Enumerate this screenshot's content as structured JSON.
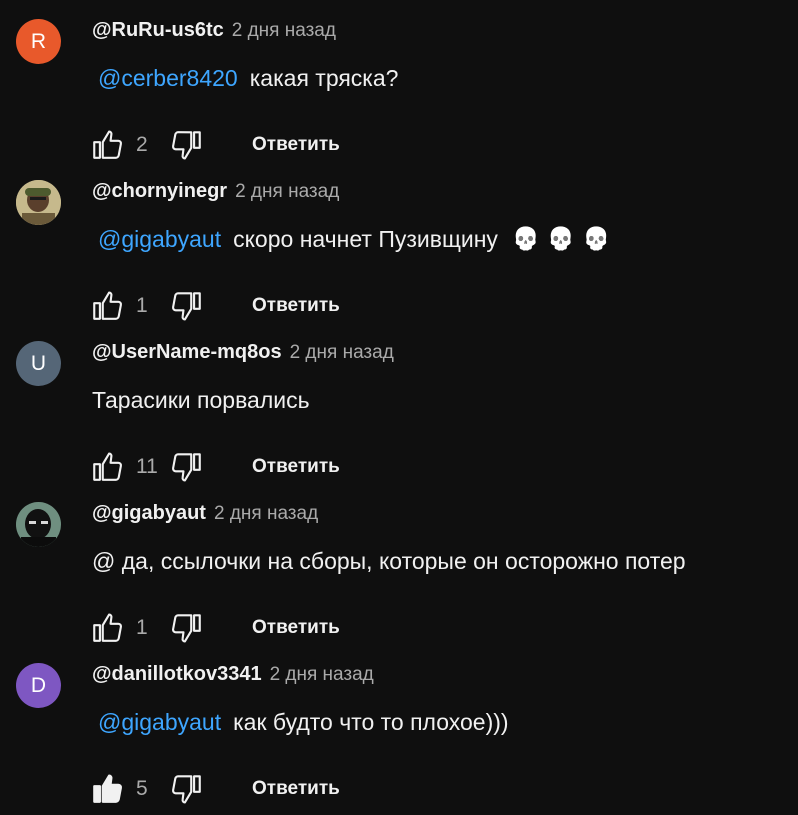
{
  "comments": [
    {
      "author": "@RuRu-us6tc",
      "time": "2 дня назад",
      "avatar_letter": "R",
      "avatar_color": "#e8592b",
      "mention": "@cerber8420",
      "text": "какая тряска?",
      "likes": "2",
      "liked": false,
      "reply_label": "Ответить"
    },
    {
      "author": "@chornyinegr",
      "time": "2 дня назад",
      "avatar_letter": "",
      "avatar_color": "#b9aa7e",
      "mention": "@gigabyaut",
      "text": "скоро начнет Пузивщину",
      "emoji": [
        "💀",
        "💀",
        "💀"
      ],
      "likes": "1",
      "liked": false,
      "reply_label": "Ответить"
    },
    {
      "author": "@UserName-mq8os",
      "time": "2 дня назад",
      "avatar_letter": "U",
      "avatar_color": "#556677",
      "mention": "",
      "text": "Тарасики порвались",
      "likes": "11",
      "liked": false,
      "reply_label": "Ответить"
    },
    {
      "author": "@gigabyaut",
      "time": "2 дня назад",
      "avatar_letter": "",
      "avatar_color": "#2b3a33",
      "mention": "",
      "text": "@ да, ссылочки на сборы, которые он осторожно потер",
      "likes": "1",
      "liked": false,
      "reply_label": "Ответить"
    },
    {
      "author": "@danillotkov3341",
      "time": "2 дня назад",
      "avatar_letter": "D",
      "avatar_color": "#7e57c2",
      "mention": "@gigabyaut",
      "text": "как будто что то плохое)))",
      "likes": "5",
      "liked": true,
      "reply_label": "Ответить"
    }
  ],
  "colors": {
    "background": "#0f0f0f",
    "mention": "#3ea6ff",
    "secondary_text": "#aaaaaa"
  }
}
